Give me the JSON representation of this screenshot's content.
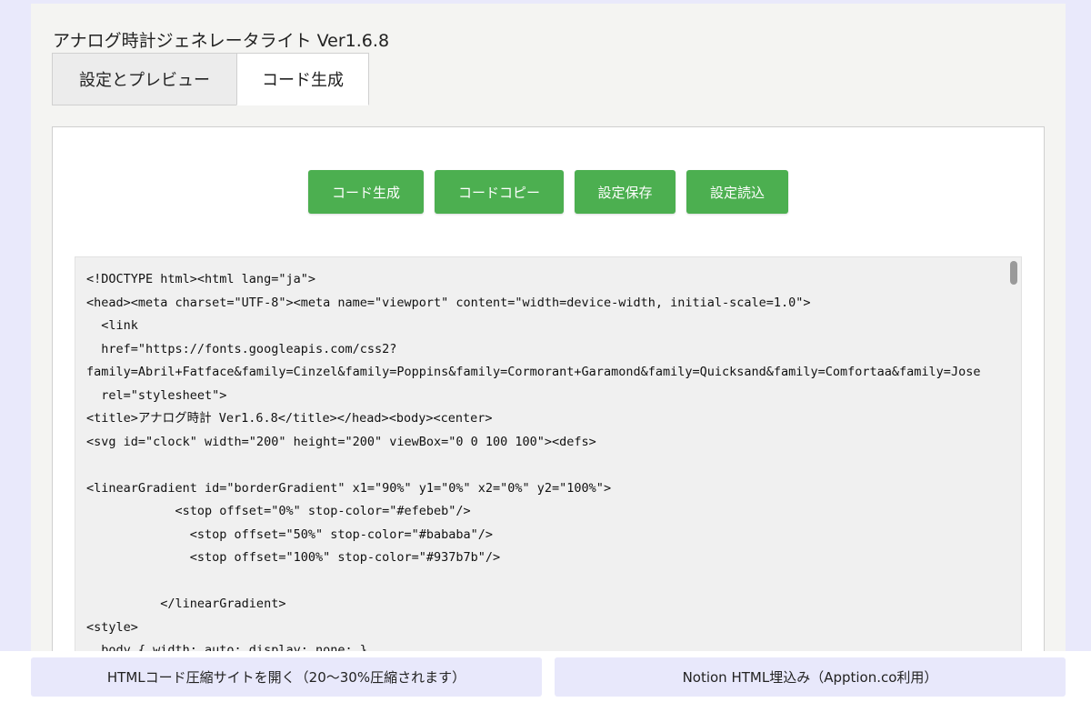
{
  "app": {
    "title": "アナログ時計ジェネレータライト Ver1.6.8"
  },
  "tabs": [
    {
      "label": "設定とプレビュー",
      "active": false
    },
    {
      "label": "コード生成",
      "active": true
    }
  ],
  "toolbar": {
    "buttons": [
      {
        "label": "コード生成"
      },
      {
        "label": "コードコピー"
      },
      {
        "label": "設定保存"
      },
      {
        "label": "設定読込"
      }
    ],
    "button_color": "#4caf50"
  },
  "code": {
    "lines": [
      "<!DOCTYPE html><html lang=\"ja\">",
      "<head><meta charset=\"UTF-8\"><meta name=\"viewport\" content=\"width=device-width, initial-scale=1.0\">",
      "  <link",
      "  href=\"https://fonts.googleapis.com/css2?",
      "family=Abril+Fatface&family=Cinzel&family=Poppins&family=Cormorant+Garamond&family=Quicksand&family=Comfortaa&family=Jose",
      "  rel=\"stylesheet\">",
      "<title>アナログ時計 Ver1.6.8</title></head><body><center>",
      "<svg id=\"clock\" width=\"200\" height=\"200\" viewBox=\"0 0 100 100\"><defs>",
      "",
      "<linearGradient id=\"borderGradient\" x1=\"90%\" y1=\"0%\" x2=\"0%\" y2=\"100%\">",
      "            <stop offset=\"0%\" stop-color=\"#efebeb\"/>",
      "              <stop offset=\"50%\" stop-color=\"#bababa\"/>",
      "              <stop offset=\"100%\" stop-color=\"#937b7b\"/>",
      "",
      "          </linearGradient>",
      "<style>",
      "  body { width: auto; display: none; }"
    ]
  },
  "footer": {
    "left_label": "HTMLコード圧縮サイトを開く（20〜30%圧縮されます）",
    "right_label": "Notion HTML埋込み（Apption.co利用）"
  }
}
